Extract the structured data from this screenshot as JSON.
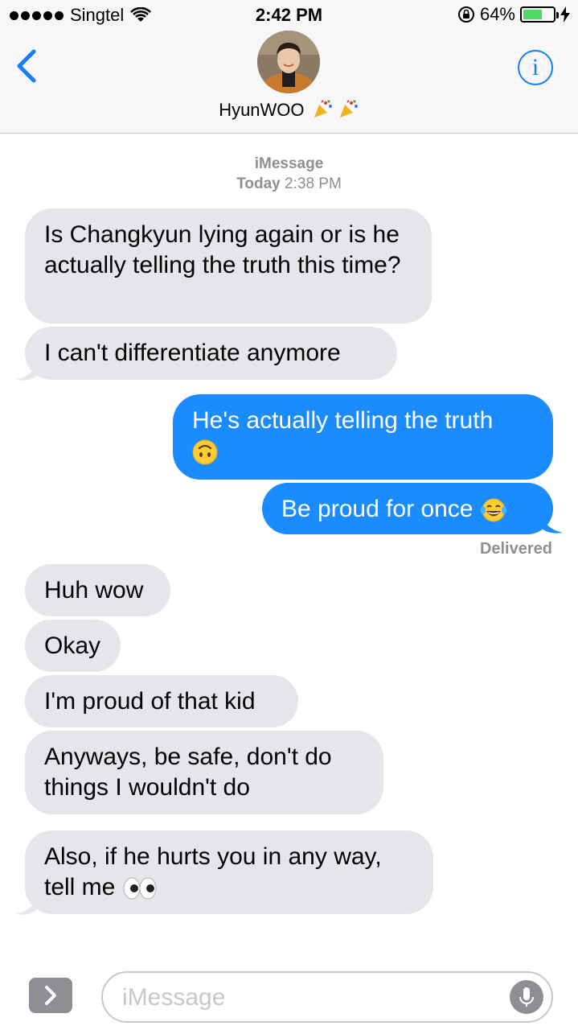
{
  "status_bar": {
    "carrier": "Singtel",
    "time": "2:42 PM",
    "battery_percent": "64%",
    "battery_level": 0.64
  },
  "header": {
    "contact_name": "HyunWOO",
    "name_emoji": "party-popper-icons",
    "back_icon": "chevron-left-icon",
    "info_icon": "info-icon",
    "accent_color": "#147efb"
  },
  "conversation": {
    "service": "iMessage",
    "day": "Today",
    "time": "2:38 PM",
    "delivered": "Delivered",
    "messages": [
      {
        "direction": "in",
        "text": "Is Changkyun lying again or is he actually telling the truth this time?"
      },
      {
        "direction": "in",
        "text": "I can't differentiate anymore"
      },
      {
        "direction": "out",
        "text": "He's actually telling the truth",
        "emoji": "upside-down-face"
      },
      {
        "direction": "out",
        "text": "Be proud for once",
        "emoji": "face-with-tears-of-joy"
      },
      {
        "direction": "in",
        "text": "Huh wow"
      },
      {
        "direction": "in",
        "text": "Okay"
      },
      {
        "direction": "in",
        "text": "I'm proud of that kid"
      },
      {
        "direction": "in",
        "text": "Anyways, be safe, don't do things I wouldn't do"
      },
      {
        "direction": "in",
        "text": "Also, if he hurts you in any way, tell me",
        "emoji": "eyes"
      }
    ]
  },
  "input_bar": {
    "placeholder": "iMessage",
    "apps_icon": "chevron-right-icon",
    "mic_icon": "microphone-icon"
  },
  "colors": {
    "incoming_bubble": "#e5e5ea",
    "outgoing_bubble": "#1a8cff",
    "meta_text": "#8e8e93"
  }
}
